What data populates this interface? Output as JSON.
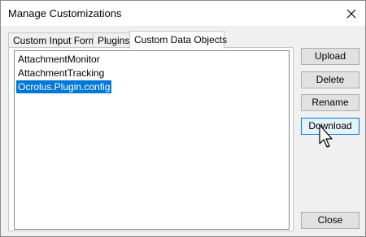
{
  "window": {
    "title": "Manage Customizations"
  },
  "icons": {
    "close": "close-icon",
    "cursor": "arrow-cursor-icon"
  },
  "tabs": [
    {
      "label": "Custom Input Forms",
      "active": false
    },
    {
      "label": "Plugins",
      "active": false
    },
    {
      "label": "Custom Data Objects",
      "active": true
    }
  ],
  "list": {
    "items": [
      {
        "label": "AttachmentMonitor",
        "selected": false
      },
      {
        "label": "AttachmentTracking",
        "selected": false
      },
      {
        "label": "Ocrolus.Plugin.config",
        "selected": true
      }
    ]
  },
  "buttons": {
    "upload": "Upload",
    "delete": "Delete",
    "rename": "Rename",
    "download": "Download",
    "close": "Close"
  },
  "colors": {
    "selection": "#0078d7",
    "window_bg": "#f0f0f0",
    "focus_border": "#0078d7"
  }
}
